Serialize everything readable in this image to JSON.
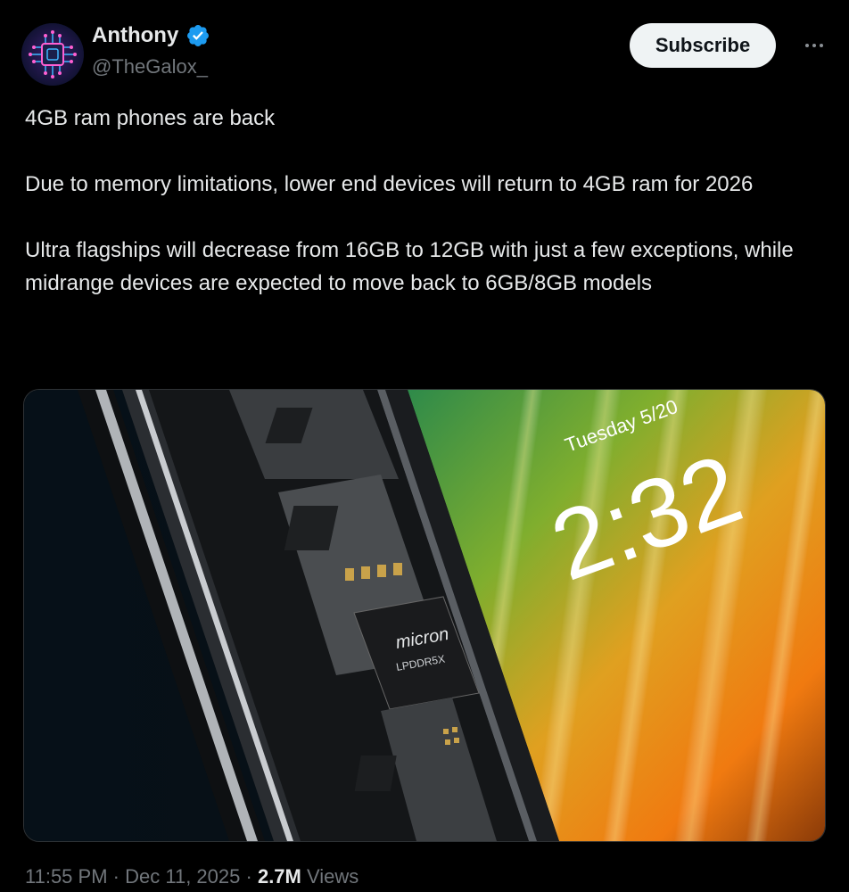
{
  "author": {
    "display_name": "Anthony",
    "handle": "@TheGalox_",
    "verified_icon": "verified-badge-icon",
    "avatar_icon": "circuit-chip-avatar"
  },
  "actions": {
    "subscribe_label": "Subscribe",
    "more_icon": "more-horizontal-icon"
  },
  "tweet": {
    "line1": "4GB ram phones are back",
    "line2": "Due to memory limitations, lower end devices will return to 4GB ram for 2026",
    "line3": "Ultra flagships will decrease from 16GB to 12GB with just a few exceptions, while midrange devices are expected to move back to 6GB/8GB models"
  },
  "media": {
    "lockscreen_date": "Tuesday 5/20",
    "lockscreen_time": "2:32",
    "chip_brand": "micron",
    "chip_model": "LPDDR5X"
  },
  "meta": {
    "time": "11:55 PM",
    "separator1": "·",
    "date": "Dec 11, 2025",
    "separator2": "·",
    "views_count": "2.7M",
    "views_label": "Views"
  },
  "colors": {
    "background": "#000000",
    "text_primary": "#e7e9ea",
    "text_secondary": "#71767b",
    "verified_blue": "#1d9bf0",
    "subscribe_bg": "#eff3f4"
  }
}
